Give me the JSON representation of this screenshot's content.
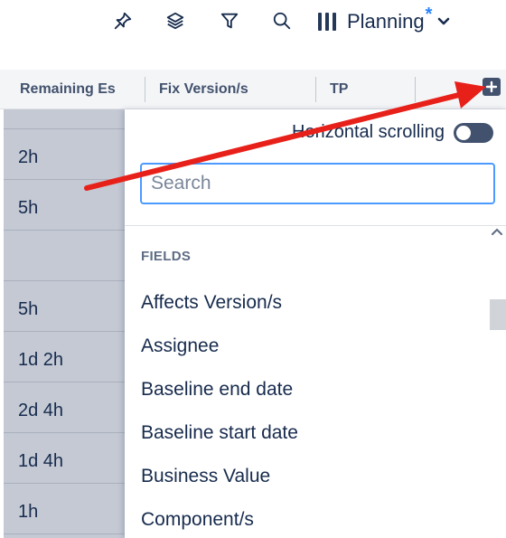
{
  "toolbar": {
    "icons": [
      "pin-icon",
      "layers-icon",
      "filter-icon",
      "search-icon"
    ],
    "planning_label": "Planning",
    "unsaved_marker": "*"
  },
  "columns": {
    "remaining": "Remaining Es",
    "fix_version": "Fix Version/s",
    "tp": "TP"
  },
  "left_values": [
    "",
    "2h",
    "5h",
    "",
    "5h",
    "1d 2h",
    "2d 4h",
    "1d 4h",
    "1h"
  ],
  "panel": {
    "horizontal_scrolling_label": "Horizontal scrolling",
    "horizontal_scrolling_on": false,
    "search_placeholder": "Search",
    "section_label": "FIELDS",
    "fields": [
      "Affects Version/s",
      "Assignee",
      "Baseline end date",
      "Baseline start date",
      "Business Value",
      "Component/s"
    ]
  },
  "colors": {
    "annotation_arrow": "#e8201a",
    "search_focus": "#4c9aff",
    "left_column_bg": "#c4c9d4"
  }
}
